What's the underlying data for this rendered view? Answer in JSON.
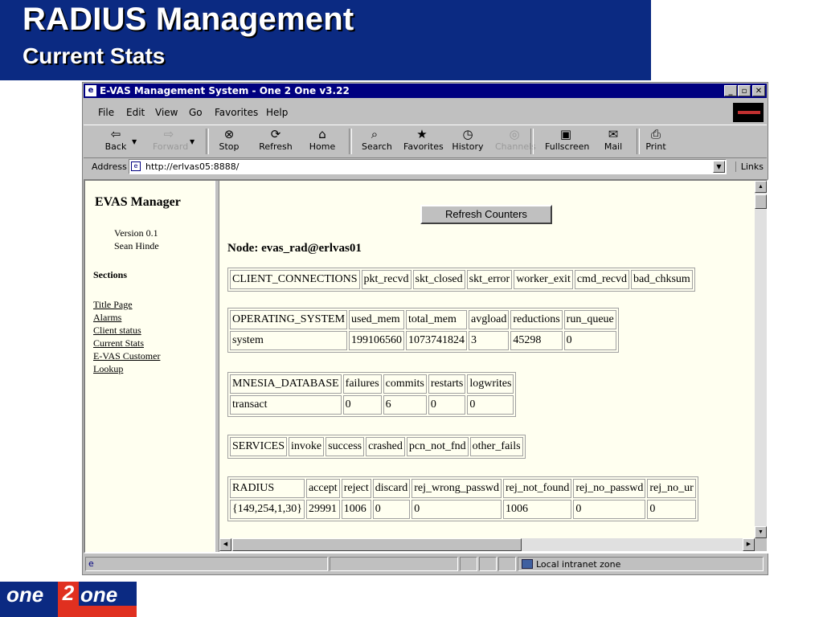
{
  "slide": {
    "title": "RADIUS Management",
    "subtitle": "Current Stats"
  },
  "window": {
    "title": "E-VAS Management System - One 2 One v3.22"
  },
  "menu": [
    "File",
    "Edit",
    "View",
    "Go",
    "Favorites",
    "Help"
  ],
  "toolbar": [
    {
      "label": "Back",
      "icon": "back-arrow-icon",
      "glyph": "⇦",
      "enabled": true
    },
    {
      "label": "Forward",
      "icon": "forward-arrow-icon",
      "glyph": "⇨",
      "enabled": false
    },
    {
      "label": "Stop",
      "icon": "stop-icon",
      "glyph": "⊗",
      "enabled": true
    },
    {
      "label": "Refresh",
      "icon": "refresh-icon",
      "glyph": "⟳",
      "enabled": true
    },
    {
      "label": "Home",
      "icon": "home-icon",
      "glyph": "⌂",
      "enabled": true
    },
    {
      "label": "Search",
      "icon": "search-icon",
      "glyph": "⌕",
      "enabled": true
    },
    {
      "label": "Favorites",
      "icon": "favorites-icon",
      "glyph": "★",
      "enabled": true
    },
    {
      "label": "History",
      "icon": "history-icon",
      "glyph": "◷",
      "enabled": true
    },
    {
      "label": "Channels",
      "icon": "channels-icon",
      "glyph": "◎",
      "enabled": false
    },
    {
      "label": "Fullscreen",
      "icon": "fullscreen-icon",
      "glyph": "▣",
      "enabled": true
    },
    {
      "label": "Mail",
      "icon": "mail-icon",
      "glyph": "✉",
      "enabled": true
    },
    {
      "label": "Print",
      "icon": "print-icon",
      "glyph": "⎙",
      "enabled": true
    }
  ],
  "address": {
    "label": "Address",
    "url": "http://erlvas05:8888/",
    "links": "Links"
  },
  "left_pane": {
    "title": "EVAS Manager",
    "version": "Version 0.1",
    "author": "Sean Hinde",
    "sections_heading": "Sections",
    "links": [
      "Title Page",
      "Alarms",
      "Client status",
      "Current Stats",
      "E-VAS Customer",
      "Lookup"
    ]
  },
  "main": {
    "refresh_button": "Refresh Counters",
    "node": "Node: evas_rad@erlvas01",
    "tables": [
      {
        "name": "client-connections-table",
        "headers": [
          "CLIENT_CONNECTIONS",
          "pkt_recvd",
          "skt_closed",
          "skt_error",
          "worker_exit",
          "cmd_recvd",
          "bad_chksum"
        ],
        "rows": []
      },
      {
        "name": "operating-system-table",
        "headers": [
          "OPERATING_SYSTEM",
          "used_mem",
          "total_mem",
          "avgload",
          "reductions",
          "run_queue"
        ],
        "rows": [
          [
            "system",
            "199106560",
            "1073741824",
            "3",
            "45298",
            "0"
          ]
        ]
      },
      {
        "name": "mnesia-database-table",
        "headers": [
          "MNESIA_DATABASE",
          "failures",
          "commits",
          "restarts",
          "logwrites"
        ],
        "rows": [
          [
            "transact",
            "0",
            "6",
            "0",
            "0"
          ]
        ]
      },
      {
        "name": "services-table",
        "headers": [
          "SERVICES",
          "invoke",
          "success",
          "crashed",
          "pcn_not_fnd",
          "other_fails"
        ],
        "rows": []
      },
      {
        "name": "radius-table",
        "headers": [
          "RADIUS",
          "accept",
          "reject",
          "discard",
          "rej_wrong_passwd",
          "rej_not_found",
          "rej_no_passwd",
          "rej_no_ur"
        ],
        "rows": [
          [
            "{149,254,1,30}",
            "29991",
            "1006",
            "0",
            "0",
            "1006",
            "0",
            "0"
          ]
        ]
      }
    ]
  },
  "status": {
    "zone": "Local intranet zone"
  },
  "logo": {
    "left": "one",
    "mid": "2",
    "right": "one"
  },
  "colors": {
    "slide_blue": "#0b2a82",
    "titlebar": "#000080",
    "chrome": "#c0c0c0",
    "page_bg": "#fffff0",
    "logo_red": "#e03020"
  }
}
